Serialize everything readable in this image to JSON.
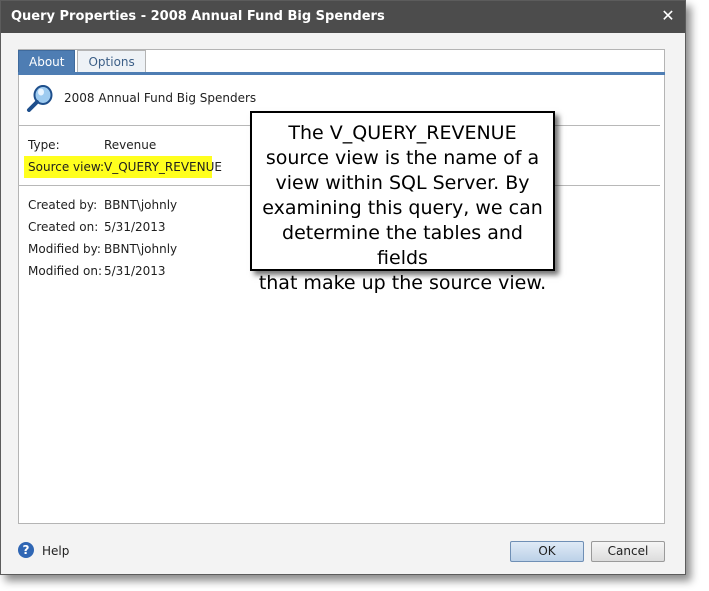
{
  "dialog": {
    "title": "Query Properties - 2008 Annual Fund Big Spenders",
    "close_icon": "close-icon"
  },
  "tabs": [
    {
      "label": "About",
      "active": true
    },
    {
      "label": "Options",
      "active": false
    }
  ],
  "query": {
    "icon": "magnifier-query-icon",
    "name": "2008 Annual Fund Big Spenders"
  },
  "properties": {
    "type_label": "Type:",
    "type_value": "Revenue",
    "source_view_label": "Source view:",
    "source_view_value": "V_QUERY_REVENUE"
  },
  "audit": {
    "created_by_label": "Created by:",
    "created_by_value": "BBNT\\johnly",
    "created_on_label": "Created on:",
    "created_on_value": "5/31/2013",
    "modified_by_label": "Modified by:",
    "modified_by_value": "BBNT\\johnly",
    "modified_on_label": "Modified on:",
    "modified_on_value": "5/31/2013"
  },
  "callout": {
    "text": "The V_QUERY_REVENUE\nsource view is the name of a\nview within SQL Server. By\nexamining this query, we can\ndetermine the tables and fields\nthat make up the source view."
  },
  "footer": {
    "help_icon": "help-icon",
    "help_label": "Help",
    "ok_label": "OK",
    "cancel_label": "Cancel"
  },
  "colors": {
    "titlebar": "#4c4c4c",
    "tab_active": "#4e7db3",
    "highlight": "#ffff1e"
  }
}
